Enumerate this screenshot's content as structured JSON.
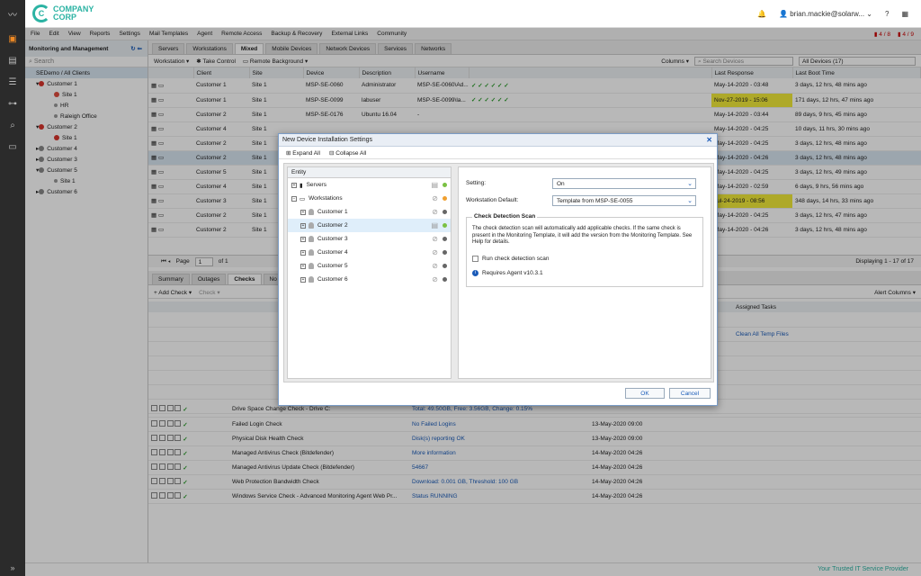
{
  "brand": {
    "name_line1": "COMPANY",
    "name_line2": "CORP",
    "tagline": "Your Trusted IT Service Provider"
  },
  "user": {
    "name": "brian.mackie@solarw..."
  },
  "menu": [
    "File",
    "Edit",
    "View",
    "Reports",
    "Settings",
    "Mail Templates",
    "Agent",
    "Remote Access",
    "Backup & Recovery",
    "External Links",
    "Community"
  ],
  "alerts": {
    "a": "4 / 8",
    "b": "4 / 9"
  },
  "tree": {
    "title": "Monitoring and Management",
    "search": "Search",
    "root": "SEDemo / All Clients",
    "nodes": [
      "Customer 1",
      "Site 1",
      "HR",
      "Raleigh Office",
      "Customer 2",
      "Site 1",
      "Customer 4",
      "Customer 3",
      "Customer 5",
      "Site 1",
      "Customer 6"
    ]
  },
  "tabs": [
    "Servers",
    "Workstations",
    "Mixed",
    "Mobile Devices",
    "Network Devices",
    "Services",
    "Networks"
  ],
  "toolbar": {
    "workstation": "Workstation",
    "take_control": "Take Control",
    "remote_bg": "Remote Background",
    "columns": "Columns",
    "search_placeholder": "Search Devices",
    "filter": "All Devices (17)"
  },
  "device_headers": [
    "Client",
    "Site",
    "Device",
    "Description",
    "Username",
    "Last Response",
    "Last Boot Time"
  ],
  "devices": [
    [
      "Customer 1",
      "Site 1",
      "MSP-SE-0060",
      "Administrator",
      "MSP-SE-0060\\Ad...",
      "May-14-2020 - 03:48",
      "3 days, 12 hrs, 48 mins ago"
    ],
    [
      "Customer 1",
      "Site 1",
      "MSP-SE-0099",
      "labuser",
      "MSP-SE-0099\\la...",
      "Nov-27-2019 - 15:06",
      "171 days, 12 hrs, 47 mins ago"
    ],
    [
      "Customer 2",
      "Site 1",
      "MSP-SE-0176",
      "Ubuntu 16.04",
      "-",
      "May-14-2020 - 03:44",
      "89 days, 9 hrs, 45 mins ago"
    ],
    [
      "Customer 4",
      "Site 1",
      "",
      "",
      "",
      "May-14-2020 - 04:25",
      "10 days, 11 hrs, 30 mins ago"
    ],
    [
      "Customer 2",
      "Site 1",
      "",
      "",
      "",
      "May-14-2020 - 04:25",
      "3 days, 12 hrs, 48 mins ago"
    ],
    [
      "Customer 2",
      "Site 1",
      "",
      "",
      "",
      "May-14-2020 - 04:26",
      "3 days, 12 hrs, 48 mins ago"
    ],
    [
      "Customer 5",
      "Site 1",
      "",
      "",
      "",
      "May-14-2020 - 04:25",
      "3 days, 12 hrs, 49 mins ago"
    ],
    [
      "Customer 4",
      "Site 1",
      "",
      "",
      "",
      "May-14-2020 - 02:59",
      "6 days, 9 hrs, 56 mins ago"
    ],
    [
      "Customer 3",
      "Site 1",
      "",
      "",
      "",
      "Jul-24-2019 - 08:56",
      "348 days, 14 hrs, 33 mins ago"
    ],
    [
      "Customer 2",
      "Site 1",
      "",
      "",
      "",
      "May-14-2020 - 04:25",
      "3 days, 12 hrs, 47 mins ago"
    ],
    [
      "Customer 2",
      "Site 1",
      "",
      "",
      "",
      "May-14-2020 - 04:26",
      "3 days, 12 hrs, 48 mins ago"
    ]
  ],
  "pager": {
    "page_label": "Page",
    "page": "1",
    "of": "of 1",
    "display": "Displaying 1 - 17 of 17"
  },
  "bottom_tabs": [
    "Summary",
    "Outages",
    "Checks",
    "No"
  ],
  "checks_toolbar": {
    "add": "Add Check",
    "check": "Check",
    "alert_cols": "Alert Columns"
  },
  "assigned_tasks": "Assigned Tasks",
  "clean_all": "Clean All Temp Files",
  "checks": [
    [
      "Drive Space Change Check - Drive C:",
      "Total: 49.50GB, Free: 3.56GB, Change: 0.15%",
      ""
    ],
    [
      "Failed Login Check",
      "No Failed Logins",
      "13-May-2020 09:00"
    ],
    [
      "Physical Disk Health Check",
      "Disk(s) reporting OK",
      "13-May-2020 09:00"
    ],
    [
      "Managed Antivirus Check (Bitdefender)",
      "More information",
      "14-May-2020 04:26"
    ],
    [
      "Managed Antivirus Update Check (Bitdefender)",
      "54667",
      "14-May-2020 04:26"
    ],
    [
      "Web Protection Bandwidth Check",
      "Download: 0.001 GB, Threshold: 100 GB",
      "14-May-2020 04:26"
    ],
    [
      "Windows Service Check - Advanced Monitoring Agent Web Pr...",
      "Status RUNNING",
      "14-May-2020 04:26"
    ]
  ],
  "dialog": {
    "title": "New Device Installation Settings",
    "expand": "Expand All",
    "collapse": "Collapse All",
    "entity": "Entity",
    "rows": [
      "Servers",
      "Workstations",
      "Customer 1",
      "Customer 2",
      "Customer 3",
      "Customer 4",
      "Customer 5",
      "Customer 6"
    ],
    "setting_label": "Setting:",
    "setting_value": "On",
    "ws_label": "Workstation Default:",
    "ws_value": "Template from MSP-SE-0055",
    "scan_title": "Check Detection Scan",
    "scan_text": "The check detection scan will automatically add applicable checks. If the same check is present in the Monitoring Template, it will add the version from the Monitoring Template. See Help for details.",
    "run_scan": "Run check detection scan",
    "requires": "Requires Agent v10.3.1",
    "ok": "OK",
    "cancel": "Cancel"
  },
  "colors": {
    "accent": "#2bb3a3",
    "link": "#1a5bb8",
    "highlight": "#f2ea3a"
  }
}
